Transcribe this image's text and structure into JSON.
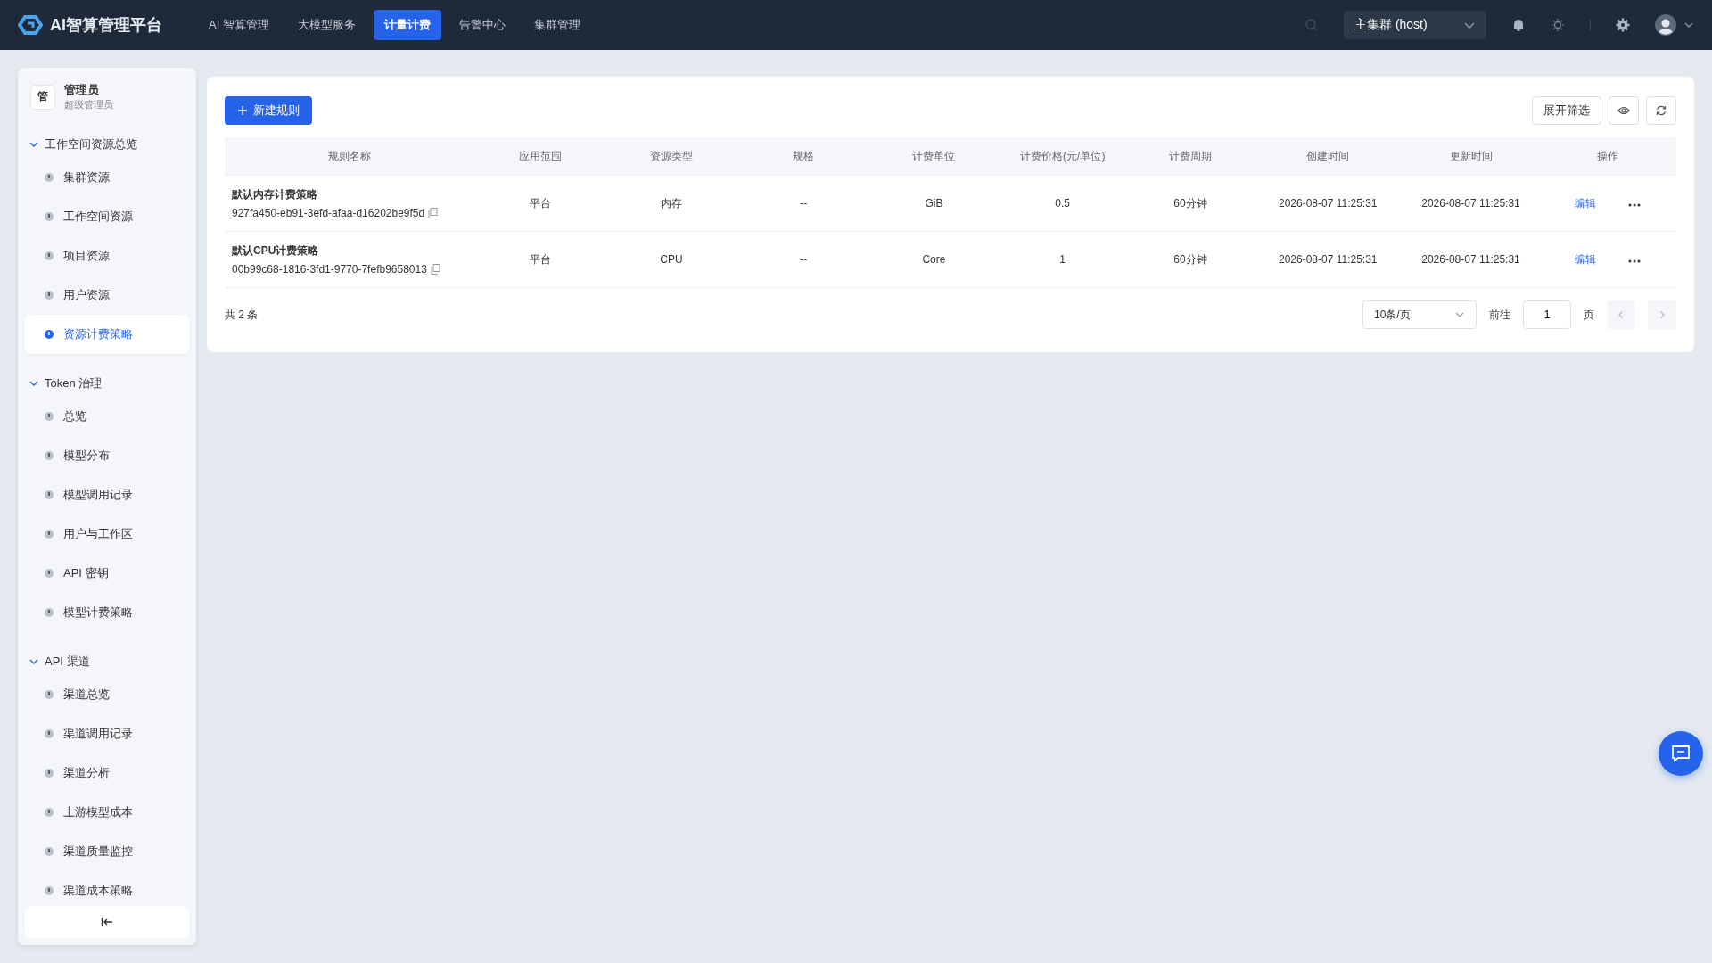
{
  "topbar": {
    "logo": "AI智算管理平台",
    "nav": [
      {
        "label": "AI 智算管理",
        "selected": false
      },
      {
        "label": "大模型服务",
        "selected": false
      },
      {
        "label": "计量计费",
        "selected": true
      },
      {
        "label": "告警中心",
        "selected": false
      },
      {
        "label": "集群管理",
        "selected": false
      }
    ],
    "cluster": "主集群 (host)"
  },
  "sidebar": {
    "user": {
      "avatar": "管",
      "name": "管理员",
      "role": "超级管理员"
    },
    "groups": [
      {
        "label": "工作空间资源总览",
        "expanded": true,
        "children": [
          {
            "label": "集群资源",
            "selected": false
          },
          {
            "label": "工作空间资源",
            "selected": false
          },
          {
            "label": "项目资源",
            "selected": false
          },
          {
            "label": "用户资源",
            "selected": false
          },
          {
            "label": "资源计费策略",
            "selected": true
          }
        ]
      },
      {
        "label": "Token 治理",
        "expanded": true,
        "children": [
          {
            "label": "总览",
            "selected": false
          },
          {
            "label": "模型分布",
            "selected": false
          },
          {
            "label": "模型调用记录",
            "selected": false
          },
          {
            "label": "用户与工作区",
            "selected": false
          },
          {
            "label": "API 密钥",
            "selected": false
          },
          {
            "label": "模型计费策略",
            "selected": false
          }
        ]
      },
      {
        "label": "API 渠道",
        "expanded": true,
        "children": [
          {
            "label": "渠道总览",
            "selected": false
          },
          {
            "label": "渠道调用记录",
            "selected": false
          },
          {
            "label": "渠道分析",
            "selected": false
          },
          {
            "label": "上游模型成本",
            "selected": false
          },
          {
            "label": "渠道质量监控",
            "selected": false
          },
          {
            "label": "渠道成本策略",
            "selected": false
          }
        ]
      }
    ]
  },
  "toolbar": {
    "create": "新建规则",
    "filter": "展开筛选"
  },
  "table": {
    "columns": [
      "规则名称",
      "应用范围",
      "资源类型",
      "规格",
      "计费单位",
      "计费价格(元/单位)",
      "计费周期",
      "创建时间",
      "更新时间",
      "操作"
    ],
    "rows": [
      {
        "cells": [
          {
            "name": "默认内存计费策略",
            "id": "927fa450-eb91-3efd-afaa-d16202be9f5d"
          },
          "平台",
          "内存",
          "--",
          "GiB",
          "0.5",
          "60分钟",
          "2026-08-07 11:25:31",
          "2026-08-07 11:25:31",
          "编辑"
        ]
      },
      {
        "cells": [
          {
            "name": "默认CPU计费策略",
            "id": "00b99c68-1816-3fd1-9770-7fefb9658013"
          },
          "平台",
          "CPU",
          "--",
          "Core",
          "1",
          "60分钟",
          "2026-08-07 11:25:31",
          "2026-08-07 11:25:31",
          "编辑"
        ]
      }
    ]
  },
  "pagination": {
    "total": "共 2 条",
    "page_size": "10条/页",
    "goto": "前往",
    "page": "1",
    "page_suffix": "页"
  }
}
